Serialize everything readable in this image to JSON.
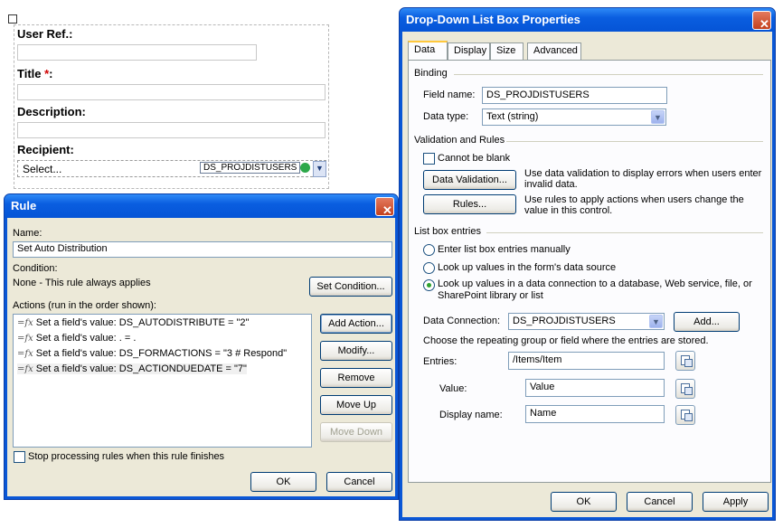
{
  "form": {
    "user_ref_label": "User Ref.:",
    "title_label": "Title ",
    "required_mark": "*",
    "title_colon": ":",
    "description_label": "Description:",
    "recipient_label": "Recipient:",
    "recipient_value": "Select...",
    "recipient_binding": "DS_PROJDISTUSERS"
  },
  "rule_dialog": {
    "title": "Rule",
    "name_label": "Name:",
    "name_value": "Set Auto Distribution",
    "condition_label": "Condition:",
    "condition_value": "None - This rule always applies",
    "set_condition_button": "Set Condition...",
    "actions_label": "Actions (run in the order shown):",
    "actions": [
      "Set a field's value: DS_AUTODISTRIBUTE = \"2\"",
      "Set a field's value: . = .",
      "Set a field's value: DS_FORMACTIONS = \"3 # Respond\"",
      "Set a field's value: DS_ACTIONDUEDATE = \"7\""
    ],
    "add_action_button": "Add Action...",
    "modify_button": "Modify...",
    "remove_button": "Remove",
    "move_up_button": "Move Up",
    "move_down_button": "Move Down",
    "stop_processing_label": "Stop processing rules when this rule finishes",
    "ok_button": "OK",
    "cancel_button": "Cancel"
  },
  "props_dialog": {
    "title": "Drop-Down List Box Properties",
    "tabs": [
      "Data",
      "Display",
      "Size",
      "Advanced"
    ],
    "binding_group": "Binding",
    "field_name_label": "Field name:",
    "field_name_value": "DS_PROJDISTUSERS",
    "data_type_label": "Data type:",
    "data_type_value": "Text (string)",
    "validation_group": "Validation and Rules",
    "cannot_be_blank_label": "Cannot be blank",
    "data_validation_button": "Data Validation...",
    "data_validation_desc": "Use data validation to display errors when users enter invalid data.",
    "rules_button": "Rules...",
    "rules_desc": "Use rules to apply actions when users change the value in this control.",
    "list_entries_group": "List box entries",
    "radio_manual": "Enter list box entries manually",
    "radio_form_source": "Look up values in the form's data source",
    "radio_connection": "Look up values in a data connection to a database, Web service, file, or SharePoint library or list",
    "data_connection_label": "Data Connection:",
    "data_connection_value": "DS_PROJDISTUSERS",
    "add_button": "Add...",
    "repeating_group_text": "Choose the repeating group or field where the entries are stored.",
    "entries_label": "Entries:",
    "entries_value": "/Items/Item",
    "value_label": "Value:",
    "value_value": "Value",
    "display_name_label": "Display name:",
    "display_name_value": "Name",
    "ok_button": "OK",
    "cancel_button": "Cancel",
    "apply_button": "Apply"
  }
}
